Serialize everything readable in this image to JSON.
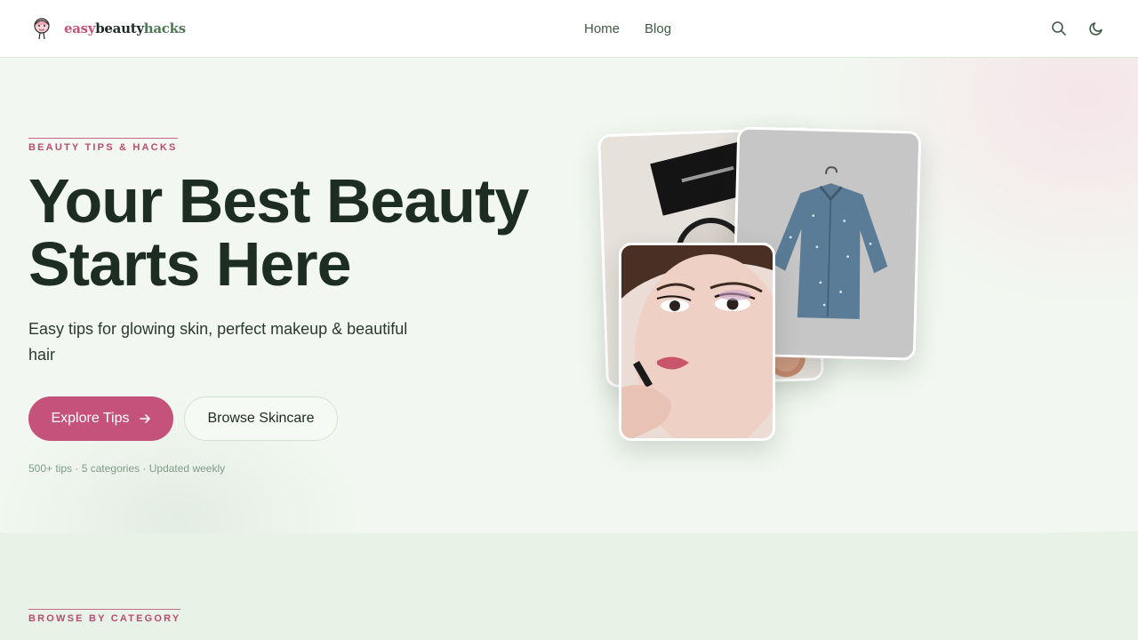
{
  "header": {
    "logo": {
      "part1": "easy",
      "part2": "beauty",
      "part3": "hacks"
    },
    "nav": [
      {
        "label": "Home"
      },
      {
        "label": "Blog"
      }
    ],
    "icons": [
      "search-icon",
      "moon-icon"
    ]
  },
  "hero": {
    "eyebrow": "BEAUTY TIPS & HACKS",
    "title_line1": "Your Best Beauty",
    "title_line2": "Starts Here",
    "subtitle": "Easy tips for glowing skin, perfect makeup & beautiful hair",
    "primary_button": "Explore Tips",
    "secondary_button": "Browse Skincare",
    "stats": "500+ tips · 5 categories · Updated weekly"
  },
  "collage": {
    "images": [
      "makeup-products-photo",
      "denim-shirt-photo",
      "woman-applying-lipstick-photo"
    ]
  },
  "section": {
    "eyebrow": "BROWSE BY CATEGORY"
  },
  "colors": {
    "accent": "#c4527b",
    "brand_green": "#4e7a58",
    "text_dark": "#1d2d22",
    "background": "#f2f8f1"
  }
}
